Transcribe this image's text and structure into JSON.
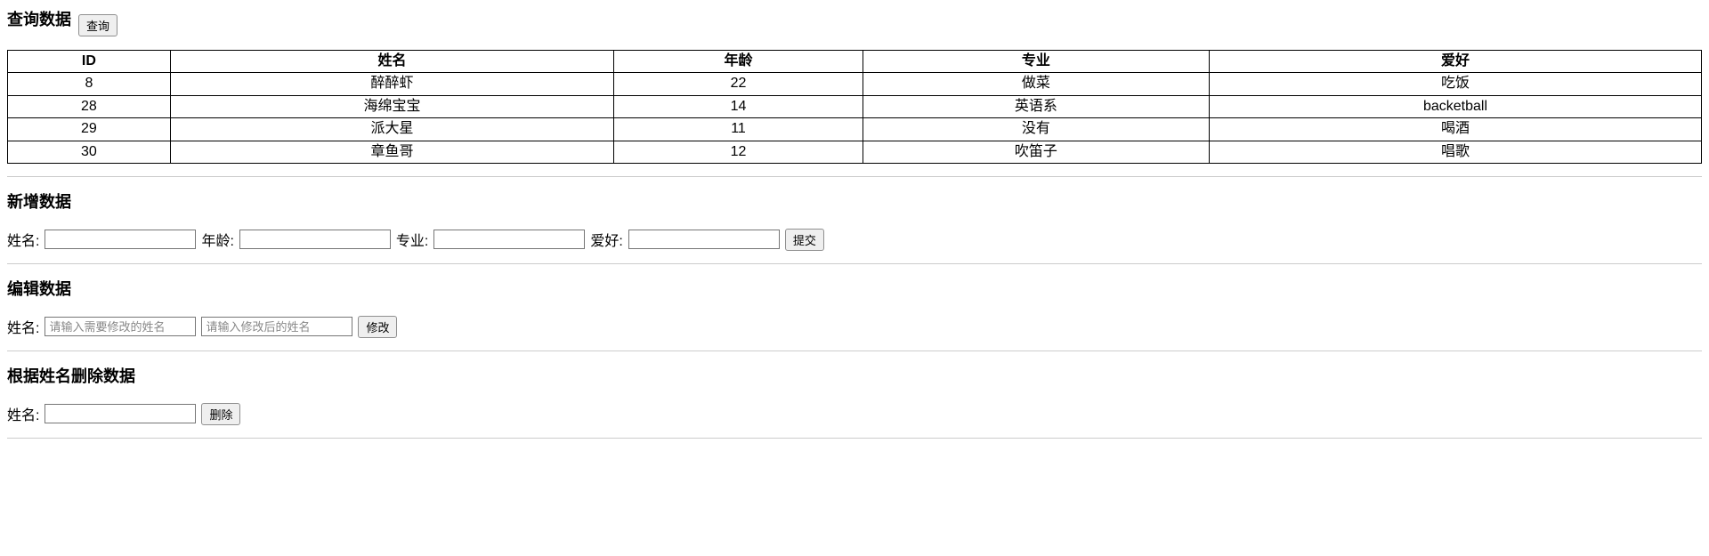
{
  "query": {
    "title": "查询数据",
    "button": "查询"
  },
  "table": {
    "headers": [
      "ID",
      "姓名",
      "年龄",
      "专业",
      "爱好"
    ],
    "rows": [
      [
        "8",
        "醉醉虾",
        "22",
        "做菜",
        "吃饭"
      ],
      [
        "28",
        "海绵宝宝",
        "14",
        "英语系",
        "backetball"
      ],
      [
        "29",
        "派大星",
        "11",
        "没有",
        "喝酒"
      ],
      [
        "30",
        "章鱼哥",
        "12",
        "吹笛子",
        "唱歌"
      ]
    ]
  },
  "add": {
    "title": "新增数据",
    "labels": {
      "name": "姓名:",
      "age": "年龄:",
      "major": "专业:",
      "hobby": "爱好:"
    },
    "button": "提交"
  },
  "edit": {
    "title": "编辑数据",
    "label": "姓名:",
    "placeholder_old": "请输入需要修改的姓名",
    "placeholder_new": "请输入修改后的姓名",
    "button": "修改"
  },
  "delete": {
    "title": "根据姓名删除数据",
    "label": "姓名:",
    "button": "删除"
  }
}
